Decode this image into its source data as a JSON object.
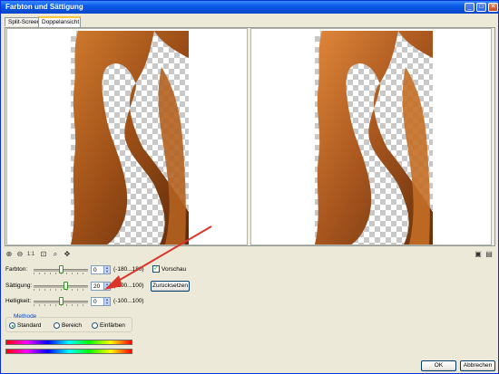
{
  "window": {
    "title": "Farbton und Sättigung",
    "controls": [
      "minimize-icon",
      "maximize-icon",
      "close-icon"
    ]
  },
  "tabs": [
    {
      "label": "Split-Screen",
      "active": false
    },
    {
      "label": "Doppelansicht",
      "active": true
    }
  ],
  "toolbar": {
    "icons": [
      "zoom-in-icon",
      "zoom-out-icon",
      "actual-size-icon",
      "fit-window-icon",
      "magnifier-icon",
      "pan-icon"
    ],
    "right_icons": [
      "camera-icon",
      "ruler-icon"
    ]
  },
  "adjust": {
    "hue": {
      "label": "Farbton:",
      "value": "0",
      "range": "(-180...180)",
      "level": 0
    },
    "saturation": {
      "label": "Sättigung:",
      "value": "20",
      "range": "(-100...100)",
      "level": 20
    },
    "lightness": {
      "label": "Helligkeit:",
      "value": "0",
      "range": "(-100...100)",
      "level": 0
    }
  },
  "preview": {
    "label": "Vorschau",
    "checked": true
  },
  "reset_button": "Zurücksetzen",
  "method": {
    "legend": "Methode",
    "options": [
      {
        "label": "Standard",
        "selected": true
      },
      {
        "label": "Bereich",
        "selected": false
      },
      {
        "label": "Einfärben",
        "selected": false
      }
    ]
  },
  "buttons": {
    "ok": "OK",
    "cancel": "Abbrechen"
  },
  "colors": {
    "accent": "#0A5AE6",
    "annotation_arrow": "#D9352B",
    "hair": "#A8561E"
  }
}
